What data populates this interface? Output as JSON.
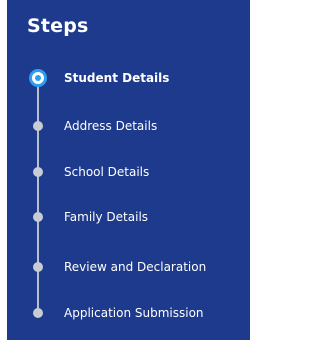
{
  "panel": {
    "title": "Steps",
    "colors": {
      "background": "#1e3a8c",
      "text": "#ffffff",
      "active_ring": "#2e9df0",
      "inactive_dot": "#c8ccd4",
      "rail": "#b9bfcc"
    }
  },
  "steps": [
    {
      "label": "Student Details",
      "state": "active"
    },
    {
      "label": "Address Details",
      "state": "pending"
    },
    {
      "label": "School Details",
      "state": "pending"
    },
    {
      "label": "Family Details",
      "state": "pending"
    },
    {
      "label": "Review and Declaration",
      "state": "pending"
    },
    {
      "label": "Application Submission",
      "state": "pending"
    }
  ]
}
